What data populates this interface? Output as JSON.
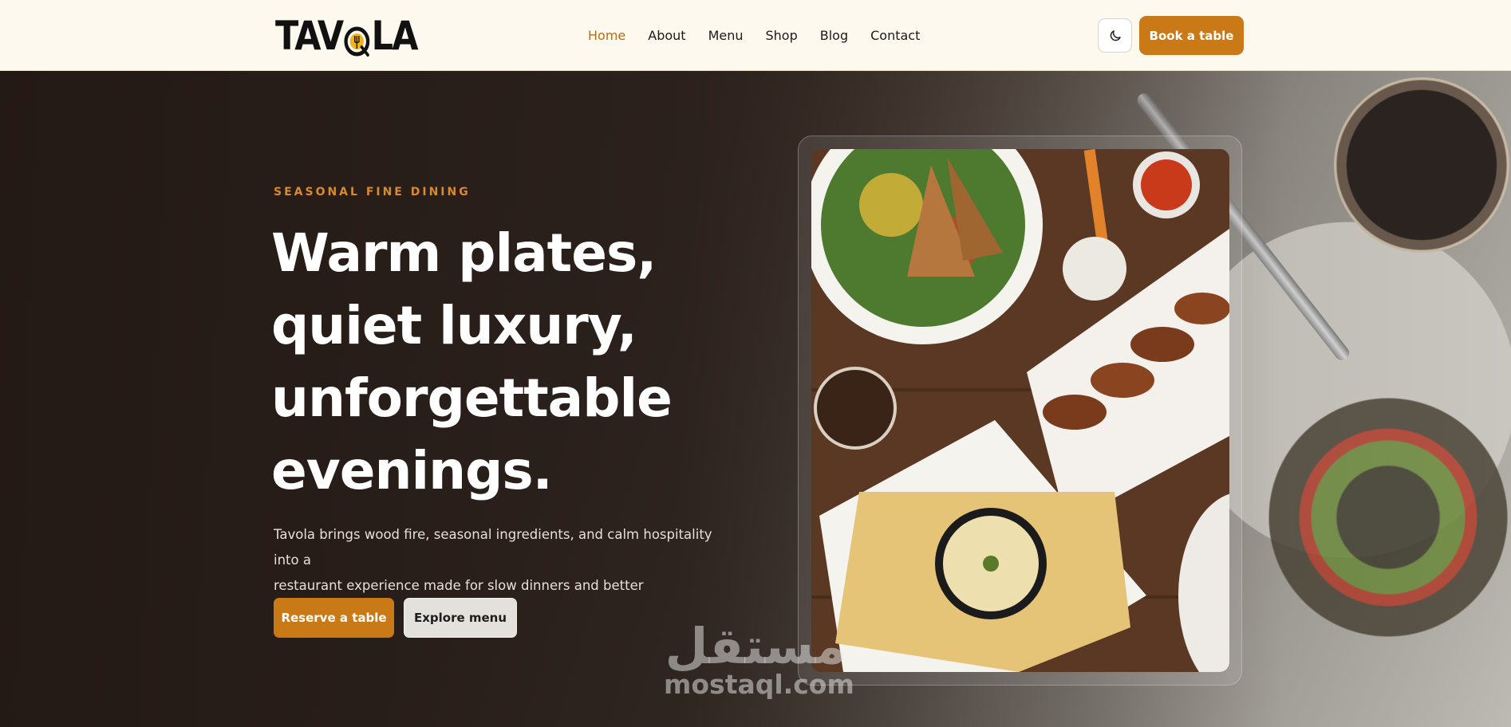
{
  "brand": {
    "logo_text_left": "TAV",
    "logo_text_right": "LA",
    "accent": "#c97a16"
  },
  "nav": {
    "links": [
      {
        "label": "Home",
        "active": true
      },
      {
        "label": "About",
        "active": false
      },
      {
        "label": "Menu",
        "active": false
      },
      {
        "label": "Shop",
        "active": false
      },
      {
        "label": "Blog",
        "active": false
      },
      {
        "label": "Contact",
        "active": false
      }
    ],
    "theme_toggle_icon": "moon-icon",
    "cta_label": "Book a table"
  },
  "hero": {
    "eyebrow": "SEASONAL FINE DINING",
    "headline_lines": [
      "Warm plates,",
      "quiet luxury,",
      "unforgettable",
      "evenings."
    ],
    "subtext_lines": [
      "Tavola brings wood fire, seasonal ingredients, and calm hospitality into a",
      "restaurant experience made for slow dinners and better conversations."
    ],
    "primary_button": "Reserve a table",
    "secondary_button": "Explore menu"
  },
  "watermark": {
    "arabic": "مستقل",
    "latin": "mostaql.com"
  }
}
